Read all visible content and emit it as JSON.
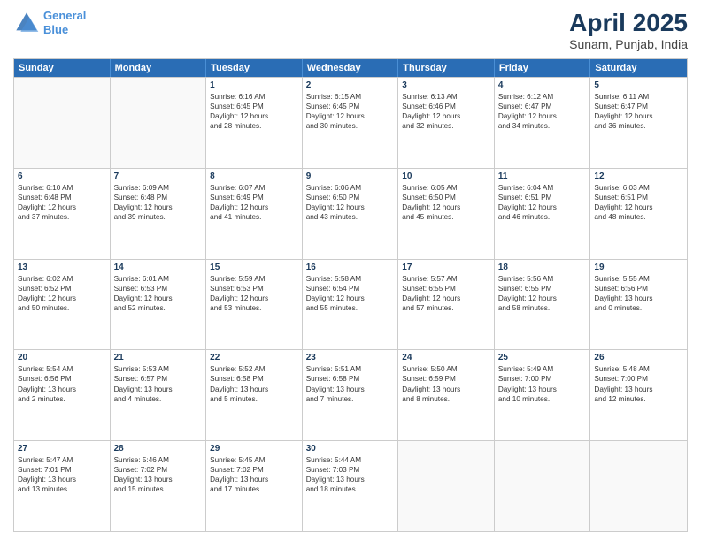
{
  "header": {
    "logo_line1": "General",
    "logo_line2": "Blue",
    "main_title": "April 2025",
    "subtitle": "Sunam, Punjab, India"
  },
  "calendar": {
    "days_of_week": [
      "Sunday",
      "Monday",
      "Tuesday",
      "Wednesday",
      "Thursday",
      "Friday",
      "Saturday"
    ],
    "weeks": [
      [
        {
          "day": "",
          "empty": true
        },
        {
          "day": "",
          "empty": true
        },
        {
          "day": "1",
          "lines": [
            "Sunrise: 6:16 AM",
            "Sunset: 6:45 PM",
            "Daylight: 12 hours",
            "and 28 minutes."
          ]
        },
        {
          "day": "2",
          "lines": [
            "Sunrise: 6:15 AM",
            "Sunset: 6:45 PM",
            "Daylight: 12 hours",
            "and 30 minutes."
          ]
        },
        {
          "day": "3",
          "lines": [
            "Sunrise: 6:13 AM",
            "Sunset: 6:46 PM",
            "Daylight: 12 hours",
            "and 32 minutes."
          ]
        },
        {
          "day": "4",
          "lines": [
            "Sunrise: 6:12 AM",
            "Sunset: 6:47 PM",
            "Daylight: 12 hours",
            "and 34 minutes."
          ]
        },
        {
          "day": "5",
          "lines": [
            "Sunrise: 6:11 AM",
            "Sunset: 6:47 PM",
            "Daylight: 12 hours",
            "and 36 minutes."
          ]
        }
      ],
      [
        {
          "day": "6",
          "lines": [
            "Sunrise: 6:10 AM",
            "Sunset: 6:48 PM",
            "Daylight: 12 hours",
            "and 37 minutes."
          ]
        },
        {
          "day": "7",
          "lines": [
            "Sunrise: 6:09 AM",
            "Sunset: 6:48 PM",
            "Daylight: 12 hours",
            "and 39 minutes."
          ]
        },
        {
          "day": "8",
          "lines": [
            "Sunrise: 6:07 AM",
            "Sunset: 6:49 PM",
            "Daylight: 12 hours",
            "and 41 minutes."
          ]
        },
        {
          "day": "9",
          "lines": [
            "Sunrise: 6:06 AM",
            "Sunset: 6:50 PM",
            "Daylight: 12 hours",
            "and 43 minutes."
          ]
        },
        {
          "day": "10",
          "lines": [
            "Sunrise: 6:05 AM",
            "Sunset: 6:50 PM",
            "Daylight: 12 hours",
            "and 45 minutes."
          ]
        },
        {
          "day": "11",
          "lines": [
            "Sunrise: 6:04 AM",
            "Sunset: 6:51 PM",
            "Daylight: 12 hours",
            "and 46 minutes."
          ]
        },
        {
          "day": "12",
          "lines": [
            "Sunrise: 6:03 AM",
            "Sunset: 6:51 PM",
            "Daylight: 12 hours",
            "and 48 minutes."
          ]
        }
      ],
      [
        {
          "day": "13",
          "lines": [
            "Sunrise: 6:02 AM",
            "Sunset: 6:52 PM",
            "Daylight: 12 hours",
            "and 50 minutes."
          ]
        },
        {
          "day": "14",
          "lines": [
            "Sunrise: 6:01 AM",
            "Sunset: 6:53 PM",
            "Daylight: 12 hours",
            "and 52 minutes."
          ]
        },
        {
          "day": "15",
          "lines": [
            "Sunrise: 5:59 AM",
            "Sunset: 6:53 PM",
            "Daylight: 12 hours",
            "and 53 minutes."
          ]
        },
        {
          "day": "16",
          "lines": [
            "Sunrise: 5:58 AM",
            "Sunset: 6:54 PM",
            "Daylight: 12 hours",
            "and 55 minutes."
          ]
        },
        {
          "day": "17",
          "lines": [
            "Sunrise: 5:57 AM",
            "Sunset: 6:55 PM",
            "Daylight: 12 hours",
            "and 57 minutes."
          ]
        },
        {
          "day": "18",
          "lines": [
            "Sunrise: 5:56 AM",
            "Sunset: 6:55 PM",
            "Daylight: 12 hours",
            "and 58 minutes."
          ]
        },
        {
          "day": "19",
          "lines": [
            "Sunrise: 5:55 AM",
            "Sunset: 6:56 PM",
            "Daylight: 13 hours",
            "and 0 minutes."
          ]
        }
      ],
      [
        {
          "day": "20",
          "lines": [
            "Sunrise: 5:54 AM",
            "Sunset: 6:56 PM",
            "Daylight: 13 hours",
            "and 2 minutes."
          ]
        },
        {
          "day": "21",
          "lines": [
            "Sunrise: 5:53 AM",
            "Sunset: 6:57 PM",
            "Daylight: 13 hours",
            "and 4 minutes."
          ]
        },
        {
          "day": "22",
          "lines": [
            "Sunrise: 5:52 AM",
            "Sunset: 6:58 PM",
            "Daylight: 13 hours",
            "and 5 minutes."
          ]
        },
        {
          "day": "23",
          "lines": [
            "Sunrise: 5:51 AM",
            "Sunset: 6:58 PM",
            "Daylight: 13 hours",
            "and 7 minutes."
          ]
        },
        {
          "day": "24",
          "lines": [
            "Sunrise: 5:50 AM",
            "Sunset: 6:59 PM",
            "Daylight: 13 hours",
            "and 8 minutes."
          ]
        },
        {
          "day": "25",
          "lines": [
            "Sunrise: 5:49 AM",
            "Sunset: 7:00 PM",
            "Daylight: 13 hours",
            "and 10 minutes."
          ]
        },
        {
          "day": "26",
          "lines": [
            "Sunrise: 5:48 AM",
            "Sunset: 7:00 PM",
            "Daylight: 13 hours",
            "and 12 minutes."
          ]
        }
      ],
      [
        {
          "day": "27",
          "lines": [
            "Sunrise: 5:47 AM",
            "Sunset: 7:01 PM",
            "Daylight: 13 hours",
            "and 13 minutes."
          ]
        },
        {
          "day": "28",
          "lines": [
            "Sunrise: 5:46 AM",
            "Sunset: 7:02 PM",
            "Daylight: 13 hours",
            "and 15 minutes."
          ]
        },
        {
          "day": "29",
          "lines": [
            "Sunrise: 5:45 AM",
            "Sunset: 7:02 PM",
            "Daylight: 13 hours",
            "and 17 minutes."
          ]
        },
        {
          "day": "30",
          "lines": [
            "Sunrise: 5:44 AM",
            "Sunset: 7:03 PM",
            "Daylight: 13 hours",
            "and 18 minutes."
          ]
        },
        {
          "day": "",
          "empty": true
        },
        {
          "day": "",
          "empty": true
        },
        {
          "day": "",
          "empty": true
        }
      ]
    ]
  }
}
